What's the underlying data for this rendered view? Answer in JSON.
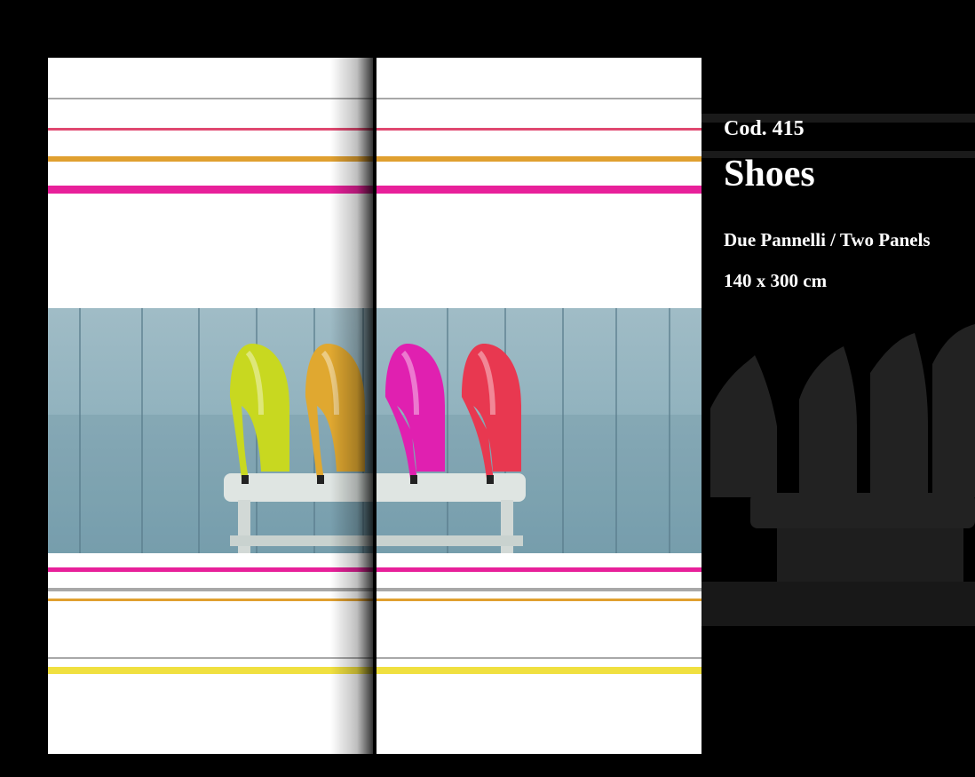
{
  "product": {
    "code": "Cod. 415",
    "name": "Shoes",
    "panels": "Due Pannelli / Two Panels",
    "size": "140 x 300 cm"
  },
  "colors": {
    "background": "#000000",
    "gray_stripe": "#a8a8a8",
    "red_stripe": "#e04870",
    "orange_stripe": "#e0a030",
    "magenta_stripe": "#e8209a",
    "yellow_stripe": "#f0e040",
    "wood": "#8fb0bc"
  },
  "shoes": [
    {
      "name": "yellow-shoe",
      "color": "#c8d820"
    },
    {
      "name": "orange-shoe",
      "color": "#e0a830"
    },
    {
      "name": "magenta-shoe",
      "color": "#e020b0"
    },
    {
      "name": "red-shoe",
      "color": "#e83850"
    }
  ]
}
